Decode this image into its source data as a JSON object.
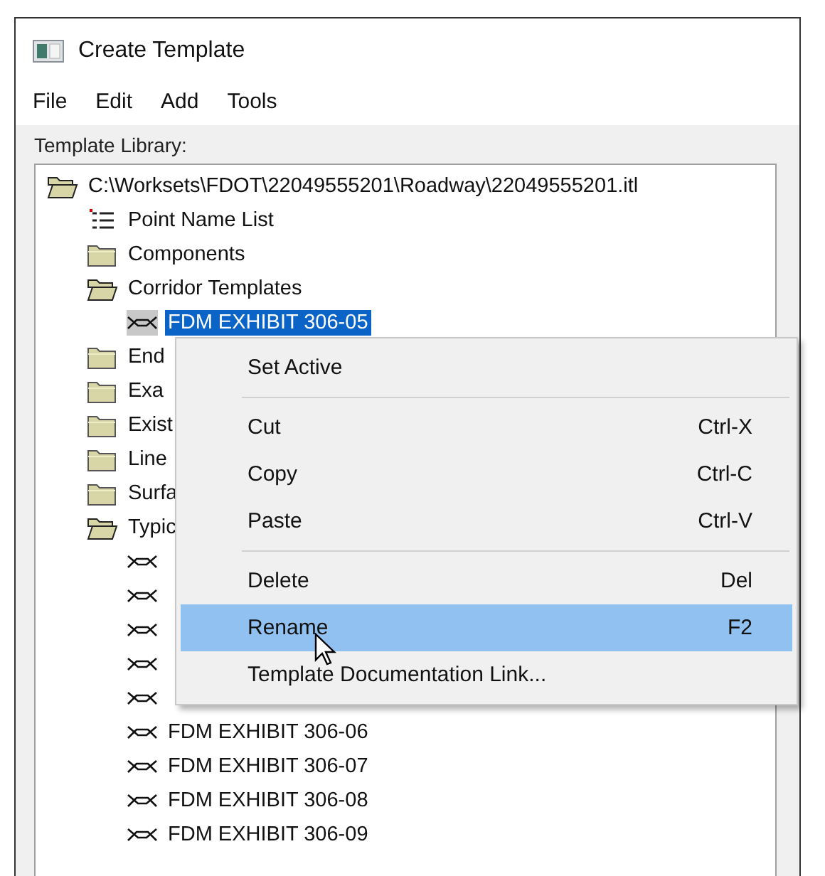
{
  "window": {
    "title": "Create Template"
  },
  "menu_bar": [
    "File",
    "Edit",
    "Add",
    "Tools"
  ],
  "library_label": "Template Library:",
  "tree": {
    "label": "C:\\Worksets\\FDOT\\22049555201\\Roadway\\22049555201.itl",
    "kind": "folder",
    "expanded": true,
    "selected": false,
    "children": [
      {
        "label": "Point Name List",
        "kind": "list",
        "selected": false
      },
      {
        "label": "Components",
        "kind": "folder",
        "expanded": false,
        "selected": false
      },
      {
        "label": "Corridor Templates",
        "kind": "folder",
        "expanded": true,
        "selected": false,
        "children": [
          {
            "label": "FDM EXHIBIT 306-05",
            "kind": "template",
            "selected": true
          }
        ]
      },
      {
        "label": "End",
        "kind": "folder",
        "expanded": false,
        "selected": false
      },
      {
        "label": "Exa",
        "kind": "folder",
        "expanded": false,
        "selected": false
      },
      {
        "label": "Exist",
        "kind": "folder",
        "expanded": false,
        "selected": false
      },
      {
        "label": "Line",
        "kind": "folder",
        "expanded": false,
        "selected": false
      },
      {
        "label": "Surfa",
        "kind": "folder",
        "expanded": false,
        "selected": false
      },
      {
        "label": "Typic",
        "kind": "folder",
        "expanded": true,
        "selected": false,
        "children": [
          {
            "kind": "template",
            "selected": false
          },
          {
            "kind": "template",
            "selected": false
          },
          {
            "kind": "template",
            "selected": false
          },
          {
            "kind": "template",
            "selected": false
          },
          {
            "kind": "template",
            "selected": false
          },
          {
            "label": "FDM EXHIBIT 306-06",
            "kind": "template",
            "selected": false
          },
          {
            "label": "FDM EXHIBIT 306-07",
            "kind": "template",
            "selected": false
          },
          {
            "label": "FDM EXHIBIT 306-08",
            "kind": "template",
            "selected": false
          },
          {
            "label": "FDM EXHIBIT 306-09",
            "kind": "template",
            "selected": false
          }
        ]
      }
    ]
  },
  "context_menu": [
    {
      "kind": "item",
      "label": "Set Active",
      "selected": false
    },
    {
      "kind": "separator"
    },
    {
      "kind": "item",
      "label": "Cut",
      "shortcut": "Ctrl-X",
      "selected": false
    },
    {
      "kind": "item",
      "label": "Copy",
      "shortcut": "Ctrl-C",
      "selected": false
    },
    {
      "kind": "item",
      "label": "Paste",
      "shortcut": "Ctrl-V",
      "selected": false
    },
    {
      "kind": "separator"
    },
    {
      "kind": "item",
      "label": "Delete",
      "shortcut": "Del",
      "selected": false
    },
    {
      "kind": "item",
      "label": "Rename",
      "shortcut": "F2",
      "selected": true
    },
    {
      "kind": "item",
      "label": "Template Documentation Link...",
      "selected": false
    }
  ]
}
